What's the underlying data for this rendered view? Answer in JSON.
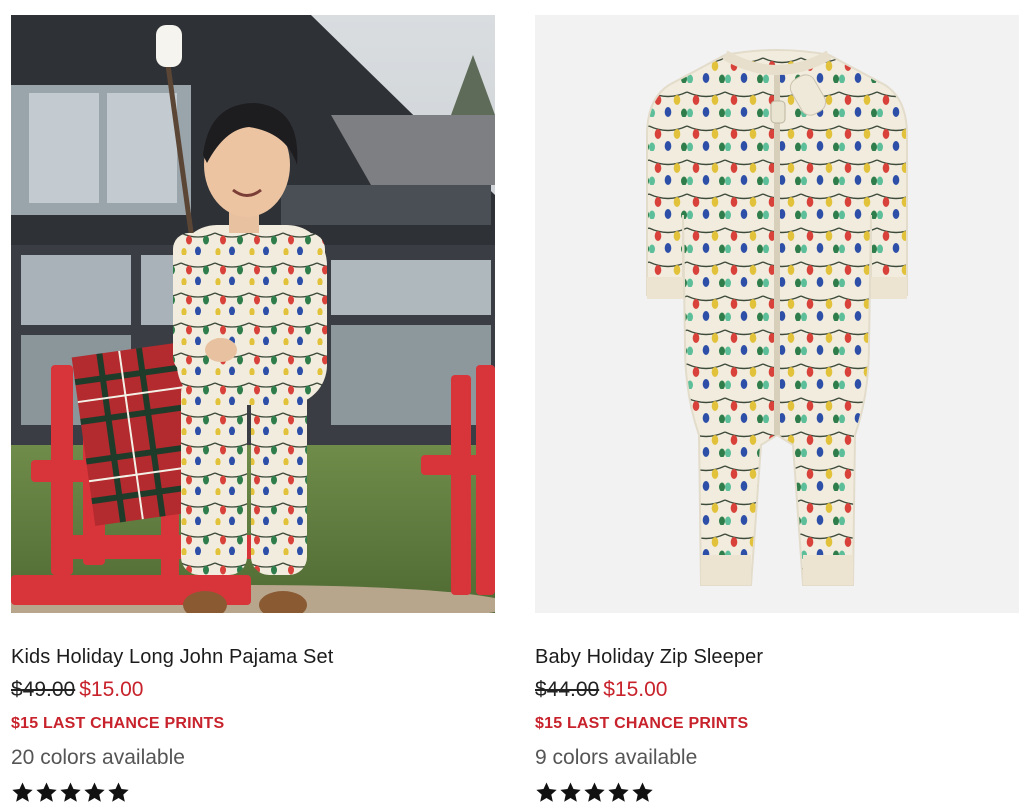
{
  "products": [
    {
      "title": "Kids Holiday Long John Pajama Set",
      "original_price": "$49.00",
      "sale_price": "$15.00",
      "promo": "$15 LAST CHANCE PRINTS",
      "colors_available": "20 colors available",
      "rating": 5,
      "image": "child-in-holiday-light-print-pajamas-outdoors"
    },
    {
      "title": "Baby Holiday Zip Sleeper",
      "original_price": "$44.00",
      "sale_price": "$15.00",
      "promo": "$15 LAST CHANCE PRINTS",
      "colors_available": "9 colors available",
      "rating": 5,
      "image": "holiday-light-print-zip-sleeper"
    }
  ],
  "colors": {
    "sale_red": "#c8232c",
    "star": "#111111",
    "pajama_cream": "#f1ecdd"
  }
}
